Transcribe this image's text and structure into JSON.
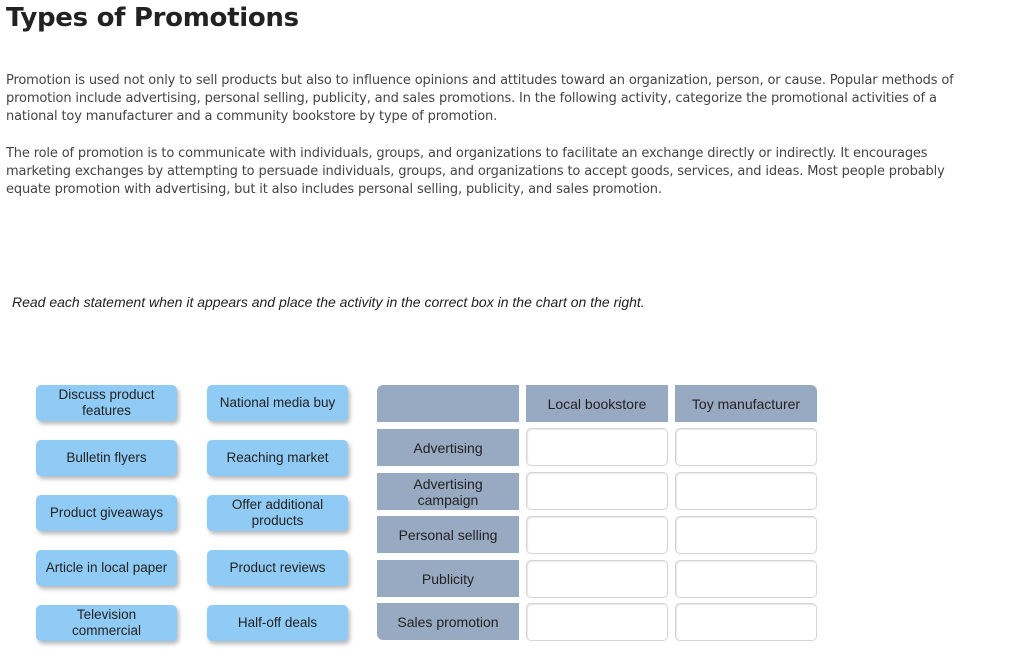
{
  "page": {
    "title": "Types of Promotions",
    "paragraphs": [
      "Promotion is used not only to sell products but also to influence opinions and attitudes toward an organization, person, or cause. Popular methods of promotion include advertising, personal selling, publicity, and sales promotions. In the following activity, categorize the promotional activities of a national toy manufacturer and a community bookstore by type of promotion.",
      "The role of promotion is to communicate with individuals, groups, and organizations to facilitate an exchange directly or indirectly. It encourages marketing exchanges by attempting to persuade individuals, groups, and organizations to accept goods, services, and ideas. Most people probably equate promotion with advertising, but it also includes personal selling, publicity, and sales promotion."
    ],
    "instructions": "Read each statement when it appears and place the activity in the correct box in the chart on the right."
  },
  "cards": [
    {
      "label": "Discuss product features"
    },
    {
      "label": "National media buy"
    },
    {
      "label": "Bulletin flyers"
    },
    {
      "label": "Reaching market"
    },
    {
      "label": "Product giveaways"
    },
    {
      "label": "Offer additional products"
    },
    {
      "label": "Article in local paper"
    },
    {
      "label": "Product reviews"
    },
    {
      "label": "Television commercial"
    },
    {
      "label": "Half-off deals"
    }
  ],
  "chart": {
    "columns": [
      "",
      "Local bookstore",
      "Toy manufacturer"
    ],
    "rows": [
      "Advertising",
      "Advertising campaign",
      "Personal selling",
      "Publicity",
      "Sales promotion"
    ],
    "colors": {
      "card": "#90cbf5",
      "header": "#98aac1",
      "cell": "#ffffff"
    }
  }
}
